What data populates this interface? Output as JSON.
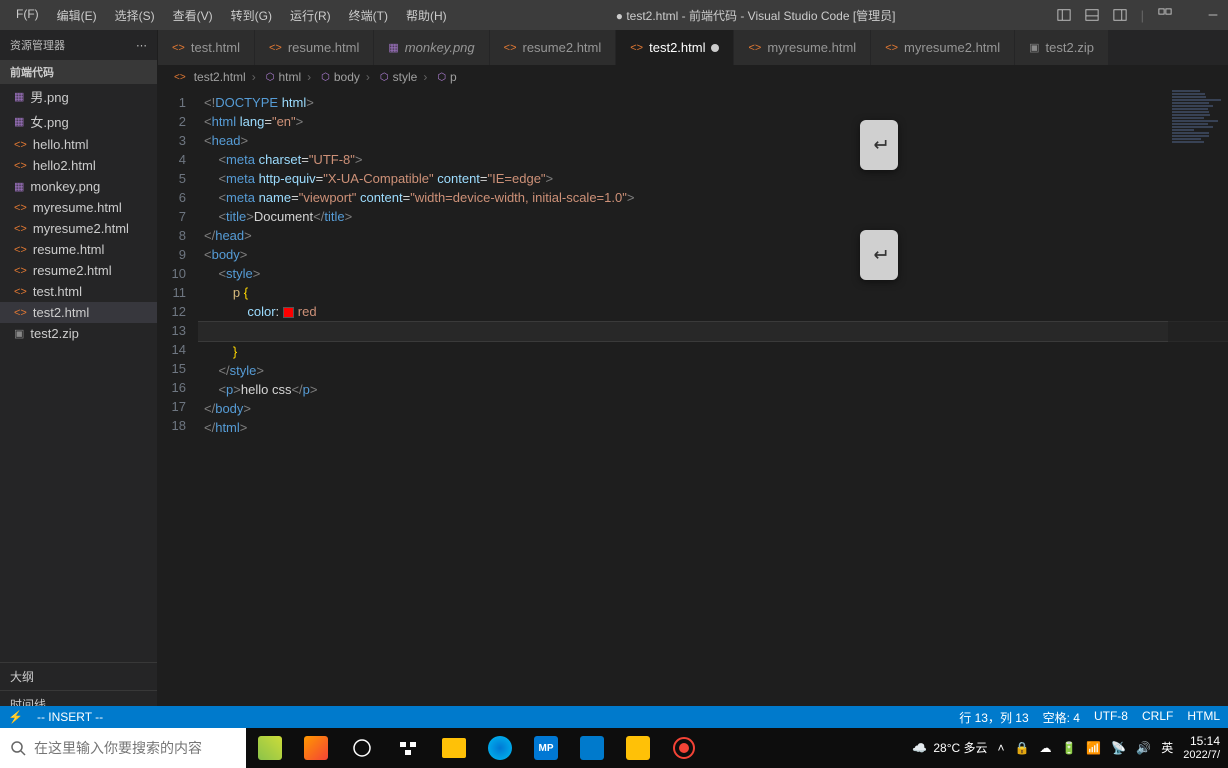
{
  "menu": [
    "F(F)",
    "编辑(E)",
    "选择(S)",
    "查看(V)",
    "转到(G)",
    "运行(R)",
    "终端(T)",
    "帮助(H)"
  ],
  "title": "● test2.html - 前端代码 - Visual Studio Code [管理员]",
  "sidebar": {
    "header": "资源管理器",
    "section": "前端代码",
    "files": [
      {
        "name": "男.png",
        "type": "png"
      },
      {
        "name": "女.png",
        "type": "png"
      },
      {
        "name": "hello.html",
        "type": "html"
      },
      {
        "name": "hello2.html",
        "type": "html"
      },
      {
        "name": "monkey.png",
        "type": "png"
      },
      {
        "name": "myresume.html",
        "type": "html"
      },
      {
        "name": "myresume2.html",
        "type": "html"
      },
      {
        "name": "resume.html",
        "type": "html"
      },
      {
        "name": "resume2.html",
        "type": "html"
      },
      {
        "name": "test.html",
        "type": "html"
      },
      {
        "name": "test2.html",
        "type": "html",
        "selected": true
      },
      {
        "name": "test2.zip",
        "type": "zip"
      }
    ],
    "bottom": [
      "大纲",
      "时间线"
    ]
  },
  "tabs": [
    {
      "label": "test.html",
      "type": "html"
    },
    {
      "label": "resume.html",
      "type": "html"
    },
    {
      "label": "monkey.png",
      "type": "png",
      "italic": true
    },
    {
      "label": "resume2.html",
      "type": "html"
    },
    {
      "label": "test2.html",
      "type": "html",
      "active": true,
      "dirty": true
    },
    {
      "label": "myresume.html",
      "type": "html"
    },
    {
      "label": "myresume2.html",
      "type": "html"
    },
    {
      "label": "test2.zip",
      "type": "zip"
    }
  ],
  "breadcrumb": [
    "test2.html",
    "html",
    "body",
    "style",
    "p"
  ],
  "code": {
    "lines": 18,
    "currentLine": 13
  },
  "statusbar": {
    "mode": "-- INSERT --",
    "pos": "行 13，列 13",
    "spaces": "空格: 4",
    "encoding": "UTF-8",
    "eol": "CRLF",
    "lang": "HTML"
  },
  "taskbar": {
    "searchPlaceholder": "在这里输入你要搜索的内容",
    "weather": "28°C 多云",
    "ime": "英",
    "time": "15:14",
    "date": "2022/7/"
  }
}
